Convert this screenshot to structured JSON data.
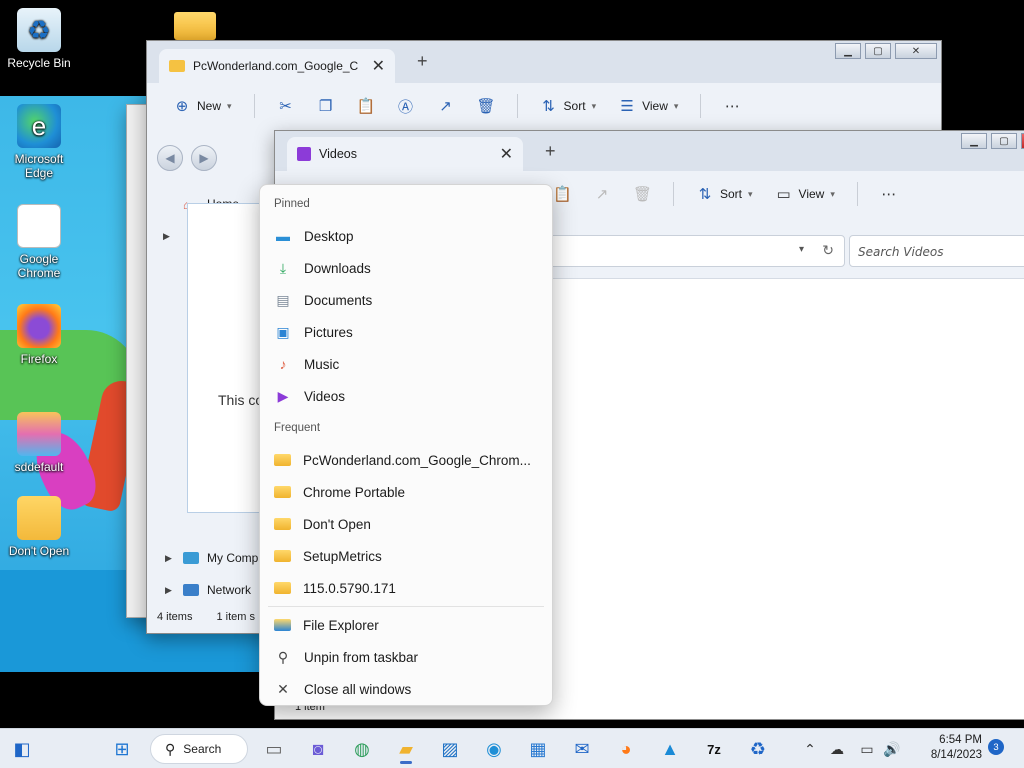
{
  "desktop": {
    "icons": [
      {
        "label": "Recycle Bin",
        "icon": "recycle-bin-icon"
      },
      {
        "label": "Microsoft Edge",
        "icon": "edge-icon"
      },
      {
        "label": "Google Chrome",
        "icon": "document-icon"
      },
      {
        "label": "Firefox",
        "icon": "firefox-icon"
      },
      {
        "label": "sddefault",
        "icon": "image-thumbnail-icon"
      },
      {
        "label": "Don't Open",
        "icon": "folder-icon"
      }
    ]
  },
  "explorer_back": {
    "tab_title": "PcWonderland.com_Google_C",
    "toolbar": {
      "new_label": "New",
      "sort_label": "Sort",
      "view_label": "View"
    },
    "sidebar": {
      "home_label": "Home",
      "my_computer_label": "My Comp",
      "network_label": "Network"
    },
    "content_message": "This co",
    "status": {
      "item_count": "4 items",
      "selected": "1 item s"
    }
  },
  "explorer_videos": {
    "tab_title": "Videos",
    "toolbar": {
      "sort_label": "Sort",
      "view_label": "View"
    },
    "search_placeholder": "Search Videos",
    "status": "1 item"
  },
  "jumplist": {
    "pinned_heading": "Pinned",
    "pinned": [
      {
        "label": "Desktop",
        "icon": "desktop-icon",
        "color": "#2b8fd6"
      },
      {
        "label": "Downloads",
        "icon": "download-icon",
        "color": "#2aa65c"
      },
      {
        "label": "Documents",
        "icon": "documents-icon",
        "color": "#7a8796"
      },
      {
        "label": "Pictures",
        "icon": "pictures-icon",
        "color": "#2b84d4"
      },
      {
        "label": "Music",
        "icon": "music-icon",
        "color": "#e0654a"
      },
      {
        "label": "Videos",
        "icon": "videos-icon",
        "color": "#8c3bd8"
      }
    ],
    "frequent_heading": "Frequent",
    "frequent": [
      {
        "label": "PcWonderland.com_Google_Chrom..."
      },
      {
        "label": "Chrome Portable"
      },
      {
        "label": "Don't Open"
      },
      {
        "label": "SetupMetrics"
      },
      {
        "label": "115.0.5790.171"
      }
    ],
    "actions": [
      {
        "label": "File Explorer",
        "icon": "file-explorer-icon"
      },
      {
        "label": "Unpin from taskbar",
        "icon": "unpin-icon"
      },
      {
        "label": "Close all windows",
        "icon": "close-icon"
      }
    ]
  },
  "taskbar": {
    "search_label": "Search",
    "clock_time": "6:54 PM",
    "clock_date": "8/14/2023",
    "notification_count": "3"
  }
}
